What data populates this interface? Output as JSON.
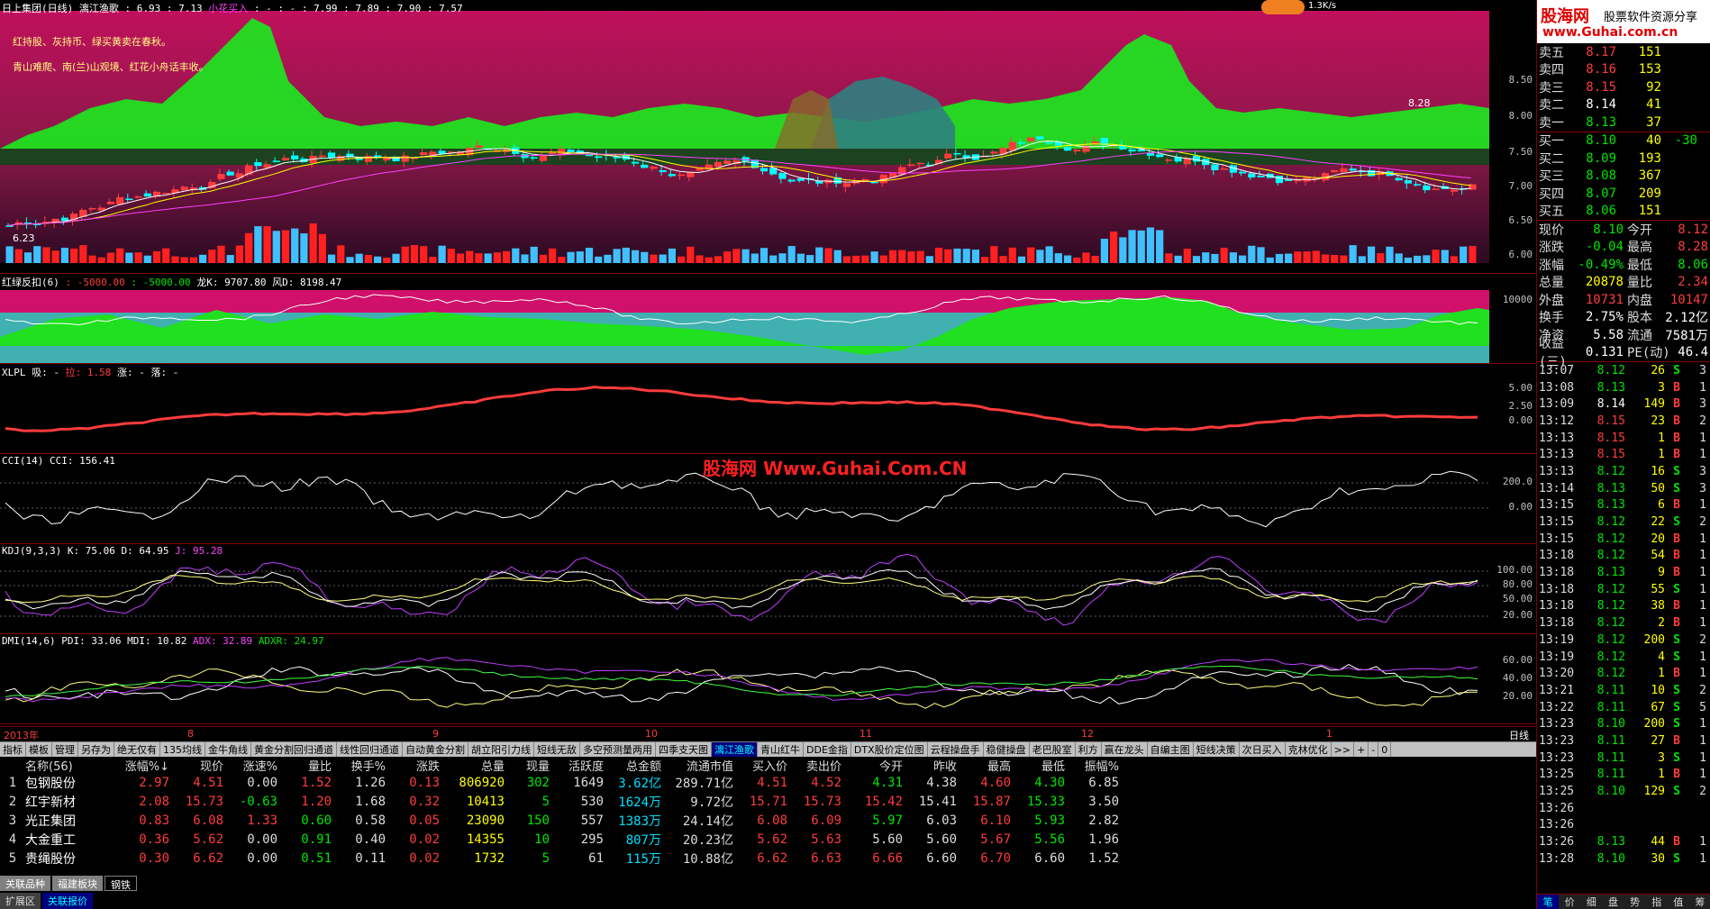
{
  "main_title": {
    "name": "日上集团(日线)",
    "indicator": "漓江渔歌",
    "values": ": 6.93 : 7.13",
    "signal": "小花买入",
    "ma_values": ": - : - : 7.99 : 7.89 : 7.90 : 7.57"
  },
  "speed_badge": "1.3K/s",
  "watermark_logo": "股海网",
  "watermark_logo_sub": "股票软件资源分享",
  "watermark_url": "www.Guhai.com.cn",
  "center_watermark": "股海网 Www.Guhai.Com.CN",
  "main_notes": [
    "红持股、灰持币、绿买黄卖在春秋。",
    "青山难爬、南(兰)山观境、红花小舟话丰收。"
  ],
  "main_labels": {
    "high": "8.28",
    "low": "6.23"
  },
  "main_yaxis": [
    "8.50",
    "8.00",
    "7.50",
    "7.00",
    "6.50",
    "6.00"
  ],
  "p2": {
    "title": "红绿反扣(6)",
    "v1": ": -5000.00",
    "v2": ": -5000.00",
    "dragon": "龙K",
    "dragon_v": ": 9707.80",
    "phoenix": "风D",
    "phoenix_v": ": 8198.47",
    "yaxis": [
      "10000"
    ]
  },
  "p3": {
    "title": "XLPL",
    "a": "吸: -",
    "b": "拉: 1.58",
    "c": "涨: -",
    "d": "落: -",
    "yaxis": [
      "5.00",
      "2.50",
      "0.00"
    ]
  },
  "p4": {
    "title": "CCI(14)",
    "val": "CCI: 156.41",
    "yaxis": [
      "200.0",
      "0.00"
    ]
  },
  "p5": {
    "title": "KDJ(9,3,3)",
    "k": "K: 75.06",
    "d": "D: 64.95",
    "j": "J: 95.28",
    "yaxis": [
      "100.00",
      "80.00",
      "50.00",
      "20.00"
    ]
  },
  "p6": {
    "title": "DMI(14,6)",
    "pdi": "PDI: 33.06",
    "mdi": "MDI: 10.82",
    "adx": "ADX: 32.89",
    "adxr": "ADXR: 24.97",
    "yaxis": [
      "60.00",
      "40.00",
      "20.00"
    ]
  },
  "date_axis": [
    "2013年",
    "8",
    "9",
    "10",
    "11",
    "12",
    "1"
  ],
  "period_label": "日线",
  "tabs": [
    "指标",
    "模板",
    "管理",
    "另存为",
    "绝无仅有",
    "135均线",
    "金牛角线",
    "黄金分割回归通道",
    "线性回归通道",
    "自动黄金分割",
    "胡立阳引力线",
    "短线无敌",
    "多空预测量两用",
    "四季支天图",
    "漓江渔歌",
    "青山红牛",
    "DDE金指",
    "DTX股价定位图",
    "云程操盘手",
    "稳健操盘",
    "老巴股室",
    "利方",
    "赢在龙头",
    "自编主图",
    "短线决策",
    "次日买入",
    "克林优化"
  ],
  "active_tab": 14,
  "tab_controls": [
    ">>",
    "+",
    "-",
    "0"
  ],
  "quote_headers": [
    "",
    "名称(56)",
    "涨幅%↓",
    "现价",
    "涨速%",
    "量比",
    "换手%",
    "涨跌",
    "总量",
    "现量",
    "活跃度",
    "总金额",
    "流通市值",
    "买入价",
    "卖出价",
    "今开",
    "昨收",
    "最高",
    "最低",
    "振幅%"
  ],
  "quote_rows": [
    [
      "1",
      "包钢股份",
      "2.97",
      "4.51",
      "0.00",
      "1.52",
      "1.26",
      "0.13",
      "806920",
      "302",
      "1649",
      "3.62亿",
      "289.71亿",
      "4.51",
      "4.52",
      "4.31",
      "4.38",
      "4.60",
      "4.30",
      "6.85"
    ],
    [
      "2",
      "红宇新材",
      "2.08",
      "15.73",
      "-0.63",
      "1.20",
      "1.68",
      "0.32",
      "10413",
      "5",
      "530",
      "1624万",
      "9.72亿",
      "15.71",
      "15.73",
      "15.42",
      "15.41",
      "15.87",
      "15.33",
      "3.50"
    ],
    [
      "3",
      "光正集团",
      "0.83",
      "6.08",
      "1.33",
      "0.60",
      "0.58",
      "0.05",
      "23090",
      "150",
      "557",
      "1383万",
      "24.14亿",
      "6.08",
      "6.09",
      "5.97",
      "6.03",
      "6.10",
      "5.93",
      "2.82"
    ],
    [
      "4",
      "大金重工",
      "0.36",
      "5.62",
      "0.00",
      "0.91",
      "0.40",
      "0.02",
      "14355",
      "10",
      "295",
      "807万",
      "20.23亿",
      "5.62",
      "5.63",
      "5.60",
      "5.60",
      "5.67",
      "5.56",
      "1.96"
    ],
    [
      "5",
      "贵绳股份",
      "0.30",
      "6.62",
      "0.00",
      "0.51",
      "0.11",
      "0.02",
      "1732",
      "5",
      "61",
      "115万",
      "10.88亿",
      "6.62",
      "6.63",
      "6.66",
      "6.60",
      "6.70",
      "6.60",
      "1.52"
    ]
  ],
  "sector_tabs": [
    "关联品种",
    "福建板块",
    "钢铁"
  ],
  "bottom_tabs": [
    "扩展区",
    "关联报价"
  ],
  "order_book": {
    "sells": [
      [
        "卖五",
        "8.17",
        "151"
      ],
      [
        "卖四",
        "8.16",
        "153"
      ],
      [
        "卖三",
        "8.15",
        "92"
      ],
      [
        "卖二",
        "8.14",
        "41"
      ],
      [
        "卖一",
        "8.13",
        "37"
      ]
    ],
    "buys": [
      [
        "买一",
        "8.10",
        "40",
        "-30"
      ],
      [
        "买二",
        "8.09",
        "193",
        ""
      ],
      [
        "买三",
        "8.08",
        "367",
        ""
      ],
      [
        "买四",
        "8.07",
        "209",
        ""
      ],
      [
        "买五",
        "8.06",
        "151",
        ""
      ]
    ]
  },
  "stats": [
    [
      "现价",
      "8.10",
      "今开",
      "8.12"
    ],
    [
      "涨跌",
      "-0.04",
      "最高",
      "8.28"
    ],
    [
      "涨幅",
      "-0.49%",
      "最低",
      "8.06"
    ],
    [
      "总量",
      "20878",
      "量比",
      "2.34"
    ],
    [
      "外盘",
      "10731",
      "内盘",
      "10147"
    ],
    [
      "换手",
      "2.75%",
      "股本",
      "2.12亿"
    ],
    [
      "净资",
      "5.58",
      "流通",
      "7581万"
    ],
    [
      "收益(三)",
      "0.131",
      "PE(动)",
      "46.4"
    ]
  ],
  "ticks": [
    [
      "13:07",
      "8.12",
      "26",
      "S",
      "3"
    ],
    [
      "13:08",
      "8.13",
      "3",
      "B",
      "1"
    ],
    [
      "13:09",
      "8.14",
      "149",
      "B",
      "3"
    ],
    [
      "13:12",
      "8.15",
      "23",
      "B",
      "2"
    ],
    [
      "13:13",
      "8.15",
      "1",
      "B",
      "1"
    ],
    [
      "13:13",
      "8.15",
      "1",
      "B",
      "1"
    ],
    [
      "13:13",
      "8.12",
      "16",
      "S",
      "3"
    ],
    [
      "13:14",
      "8.13",
      "50",
      "S",
      "3"
    ],
    [
      "13:15",
      "8.13",
      "6",
      "B",
      "1"
    ],
    [
      "13:15",
      "8.12",
      "22",
      "S",
      "2"
    ],
    [
      "13:15",
      "8.12",
      "20",
      "B",
      "1"
    ],
    [
      "13:18",
      "8.12",
      "54",
      "B",
      "1"
    ],
    [
      "13:18",
      "8.13",
      "9",
      "B",
      "1"
    ],
    [
      "13:18",
      "8.12",
      "55",
      "S",
      "1"
    ],
    [
      "13:18",
      "8.12",
      "38",
      "B",
      "1"
    ],
    [
      "13:18",
      "8.12",
      "2",
      "B",
      "1"
    ],
    [
      "13:19",
      "8.12",
      "200",
      "S",
      "2"
    ],
    [
      "13:19",
      "8.12",
      "4",
      "S",
      "1"
    ],
    [
      "13:20",
      "8.12",
      "1",
      "B",
      "1"
    ],
    [
      "13:21",
      "8.11",
      "10",
      "S",
      "2"
    ],
    [
      "13:22",
      "8.11",
      "67",
      "S",
      "5"
    ],
    [
      "13:23",
      "8.10",
      "200",
      "S",
      "1"
    ],
    [
      "13:23",
      "8.11",
      "27",
      "B",
      "1"
    ],
    [
      "13:23",
      "8.11",
      "3",
      "S",
      "1"
    ],
    [
      "13:25",
      "8.11",
      "1",
      "B",
      "1"
    ],
    [
      "13:25",
      "8.10",
      "129",
      "S",
      "2"
    ],
    [
      "13:26",
      "",
      "",
      "",
      ""
    ],
    [
      "13:26",
      "",
      "",
      "",
      ""
    ],
    [
      "13:26",
      "8.13",
      "44",
      "B",
      "1"
    ],
    [
      "13:28",
      "8.10",
      "30",
      "S",
      "1"
    ]
  ],
  "right_bottom_tabs": [
    "笔",
    "价",
    "细",
    "盘",
    "势",
    "指",
    "值",
    "筹"
  ],
  "colors": {
    "up": "#ff3c3c",
    "down": "#00e600",
    "bg": "#000000",
    "border": "#800000",
    "magenta_bg": "#c0106a",
    "green_fill": "#20e020"
  }
}
